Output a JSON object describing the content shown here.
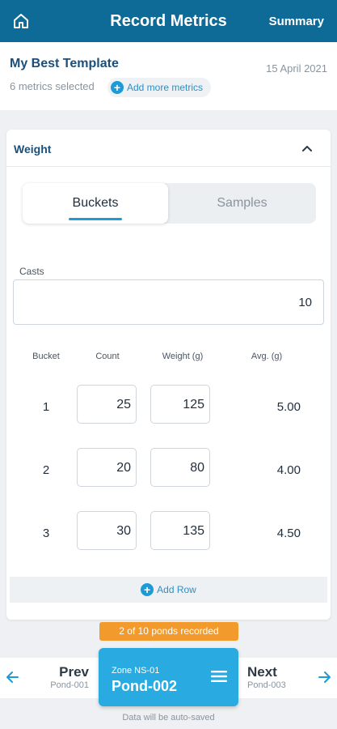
{
  "header": {
    "title": "Record Metrics",
    "summary_label": "Summary",
    "home_icon": "home-icon"
  },
  "template": {
    "name": "My Best Template",
    "date": "15 April 2021",
    "metrics_selected": "6 metrics selected",
    "add_more_label": "Add more metrics"
  },
  "weight": {
    "title": "Weight",
    "tabs": [
      "Buckets",
      "Samples"
    ],
    "active_tab": "Buckets",
    "casts_label": "Casts",
    "casts_value": "10",
    "columns": [
      "Bucket",
      "Count",
      "Weight (g)",
      "Avg. (g)"
    ],
    "rows": [
      {
        "bucket": "1",
        "count": "25",
        "weight": "125",
        "avg": "5.00"
      },
      {
        "bucket": "2",
        "count": "20",
        "weight": "80",
        "avg": "4.00"
      },
      {
        "bucket": "3",
        "count": "30",
        "weight": "135",
        "avg": "4.50"
      }
    ],
    "add_row_label": "Add Row"
  },
  "footer": {
    "progress_badge": "2 of 10 ponds recorded",
    "prev_label": "Prev",
    "prev_pond": "Pond-001",
    "next_label": "Next",
    "next_pond": "Pond-003",
    "zone": "Zone NS-01",
    "current_pond": "Pond-002",
    "autosave_note": "Data will be auto-saved"
  },
  "colors": {
    "header_bg": "#0e6a97",
    "accent": "#1e9ad6",
    "pond_card": "#29abe2",
    "badge": "#f39a2c"
  }
}
